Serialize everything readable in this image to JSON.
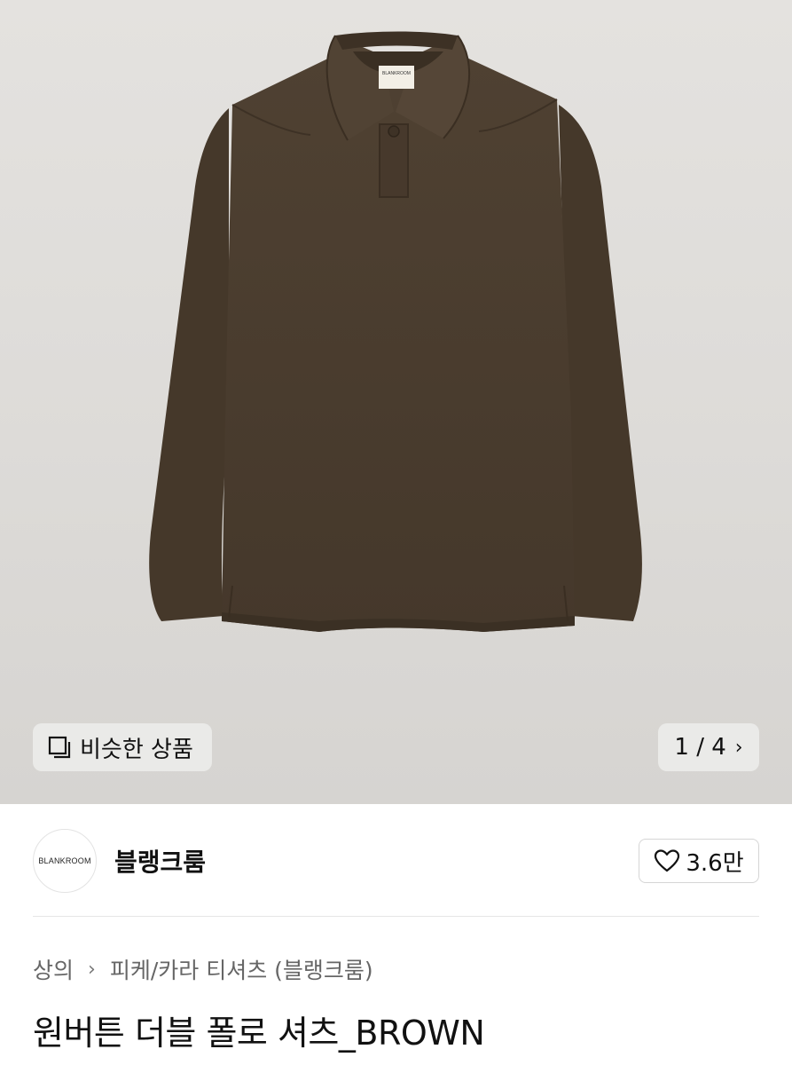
{
  "gallery": {
    "similar_label": "비슷한 상품",
    "counter": "1 / 4",
    "tag_brand": "BLANKROOM"
  },
  "seller": {
    "logo_text": "BLANKROOM",
    "name": "블랭크룸",
    "likes": "3.6만"
  },
  "breadcrumb": {
    "category": "상의",
    "subcategory": "피케/카라 티셔츠 (블랭크룸)"
  },
  "product": {
    "title": "원버튼 더블 폴로 셔츠_BROWN"
  },
  "colors": {
    "shirt": "#4a3c2e",
    "background": "#e0dedb"
  },
  "icons": {
    "similar": "stacked-squares-icon",
    "next": "chevron-right-icon",
    "breadcrumb_sep": "chevron-right-icon",
    "like": "heart-outline-icon"
  }
}
